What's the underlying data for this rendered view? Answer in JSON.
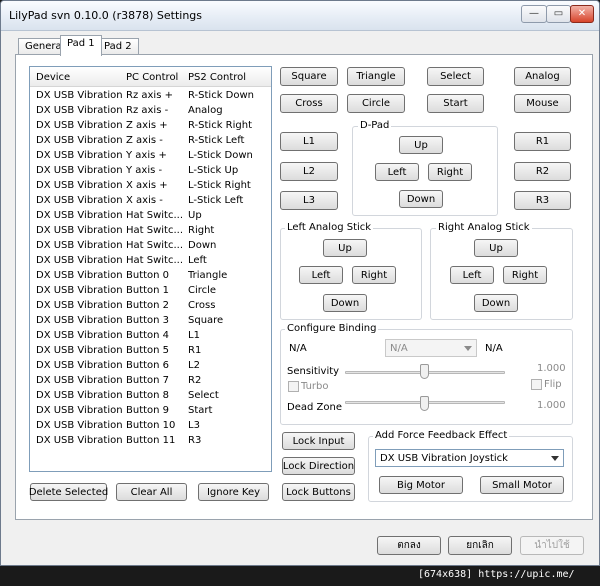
{
  "window": {
    "title": "LilyPad svn 0.10.0 (r3878) Settings"
  },
  "tabs": [
    "General",
    "Pad 1",
    "Pad 2"
  ],
  "device_list": {
    "headers": [
      "Device",
      "PC Control",
      "PS2 Control"
    ],
    "rows": [
      [
        "DX USB Vibration...",
        "Rz axis +",
        "R-Stick Down"
      ],
      [
        "DX USB Vibration...",
        "Rz axis -",
        "Analog"
      ],
      [
        "DX USB Vibration...",
        "Z axis +",
        "R-Stick Right"
      ],
      [
        "DX USB Vibration...",
        "Z axis -",
        "R-Stick Left"
      ],
      [
        "DX USB Vibration...",
        "Y axis +",
        "L-Stick Down"
      ],
      [
        "DX USB Vibration...",
        "Y axis -",
        "L-Stick Up"
      ],
      [
        "DX USB Vibration...",
        "X axis +",
        "L-Stick Right"
      ],
      [
        "DX USB Vibration...",
        "X axis -",
        "L-Stick Left"
      ],
      [
        "DX USB Vibration...",
        "Hat Switc...",
        "Up"
      ],
      [
        "DX USB Vibration...",
        "Hat Switc...",
        "Right"
      ],
      [
        "DX USB Vibration...",
        "Hat Switc...",
        "Down"
      ],
      [
        "DX USB Vibration...",
        "Hat Switc...",
        "Left"
      ],
      [
        "DX USB Vibration...",
        "Button 0",
        "Triangle"
      ],
      [
        "DX USB Vibration...",
        "Button 1",
        "Circle"
      ],
      [
        "DX USB Vibration...",
        "Button 2",
        "Cross"
      ],
      [
        "DX USB Vibration...",
        "Button 3",
        "Square"
      ],
      [
        "DX USB Vibration...",
        "Button 4",
        "L1"
      ],
      [
        "DX USB Vibration...",
        "Button 5",
        "R1"
      ],
      [
        "DX USB Vibration...",
        "Button 6",
        "L2"
      ],
      [
        "DX USB Vibration...",
        "Button 7",
        "R2"
      ],
      [
        "DX USB Vibration...",
        "Button 8",
        "Select"
      ],
      [
        "DX USB Vibration...",
        "Button 9",
        "Start"
      ],
      [
        "DX USB Vibration...",
        "Button 10",
        "L3"
      ],
      [
        "DX USB Vibration...",
        "Button 11",
        "R3"
      ]
    ]
  },
  "list_buttons": {
    "delete": "Delete Selected",
    "clear": "Clear All",
    "ignore": "Ignore Key"
  },
  "pad_buttons": {
    "square": "Square",
    "triangle": "Triangle",
    "select": "Select",
    "analog": "Analog",
    "cross": "Cross",
    "circle": "Circle",
    "start": "Start",
    "mouse": "Mouse",
    "l1": "L1",
    "l2": "L2",
    "l3": "L3",
    "r1": "R1",
    "r2": "R2",
    "r3": "R3"
  },
  "dpad": {
    "label": "D-Pad",
    "up": "Up",
    "left": "Left",
    "right": "Right",
    "down": "Down"
  },
  "left_stick": {
    "label": "Left Analog Stick",
    "up": "Up",
    "left": "Left",
    "right": "Right",
    "down": "Down"
  },
  "right_stick": {
    "label": "Right Analog Stick",
    "up": "Up",
    "left": "Left",
    "right": "Right",
    "down": "Down"
  },
  "configure": {
    "label": "Configure Binding",
    "left_value": "N/A",
    "select_value": "N/A",
    "right_value": "N/A",
    "sensitivity_label": "Sensitivity",
    "sensitivity_value": "1.000",
    "turbo_label": "Turbo",
    "flip_label": "Flip",
    "deadzone_label": "Dead Zone",
    "deadzone_value": "1.000"
  },
  "lock_buttons": {
    "input": "Lock Input",
    "direction": "Lock Direction",
    "buttons": "Lock Buttons"
  },
  "force_feedback": {
    "label": "Add Force Feedback Effect",
    "device": "DX USB Vibration Joystick",
    "big_motor": "Big Motor",
    "small_motor": "Small Motor"
  },
  "dialog": {
    "ok": "ตกลง",
    "cancel": "ยกเลิก",
    "apply": "นำไปใช้"
  },
  "watermark": "[674x638] https://upic.me/"
}
